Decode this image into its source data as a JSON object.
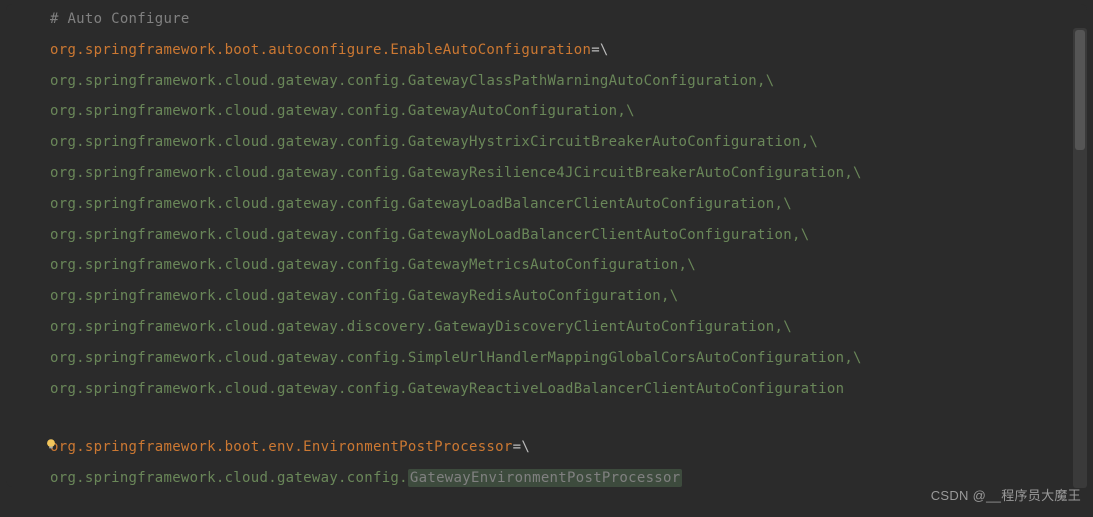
{
  "editor": {
    "comment": "# Auto Configure",
    "key1_head": "org",
    "key1_tail": ".springframework.boot.autoconfigure.EnableAutoConfiguration",
    "eqbs": "=\\",
    "lines": [
      {
        "prefix": "org.springframework.cloud.gateway.config.",
        "name": "GatewayClassPathWarningAutoConfiguration",
        "suffix": ",\\"
      },
      {
        "prefix": "org.springframework.cloud.gateway.config.",
        "name": "GatewayAutoConfiguration",
        "suffix": ",\\"
      },
      {
        "prefix": "org.springframework.cloud.gateway.config.",
        "name": "GatewayHystrixCircuitBreakerAutoConfiguration",
        "suffix": ",\\"
      },
      {
        "prefix": "org.springframework.cloud.gateway.config.",
        "name": "GatewayResilience4JCircuitBreakerAutoConfiguration",
        "suffix": ",\\"
      },
      {
        "prefix": "org.springframework.cloud.gateway.config.",
        "name": "GatewayLoadBalancerClientAutoConfiguration",
        "suffix": ",\\"
      },
      {
        "prefix": "org.springframework.cloud.gateway.config.",
        "name": "GatewayNoLoadBalancerClientAutoConfiguration",
        "suffix": ",\\"
      },
      {
        "prefix": "org.springframework.cloud.gateway.config.",
        "name": "GatewayMetricsAutoConfiguration",
        "suffix": ",\\"
      },
      {
        "prefix": "org.springframework.cloud.gateway.config.",
        "name": "GatewayRedisAutoConfiguration",
        "suffix": ",\\"
      },
      {
        "prefix": "org.springframework.cloud.gateway.discovery.",
        "name": "GatewayDiscoveryClientAutoConfiguration",
        "suffix": ",\\"
      },
      {
        "prefix": "org.springframework.cloud.gateway.config.",
        "name": "SimpleUrlHandlerMappingGlobalCorsAutoConfiguration",
        "suffix": ",\\"
      },
      {
        "prefix": "org.springframework.cloud.gateway.config.",
        "name": "GatewayReactiveLoadBalancerClientAutoConfiguration",
        "suffix": ""
      }
    ],
    "key2_head": "org",
    "key2_tail": ".springframework.boot.env.EnvironmentPostProcessor",
    "eqbs2": "=\\",
    "value2_prefix": "org.springframework.cloud.gateway.config.",
    "value2_name": "GatewayEnvironmentPostProcessor"
  },
  "watermark": "CSDN @__程序员大魔王"
}
